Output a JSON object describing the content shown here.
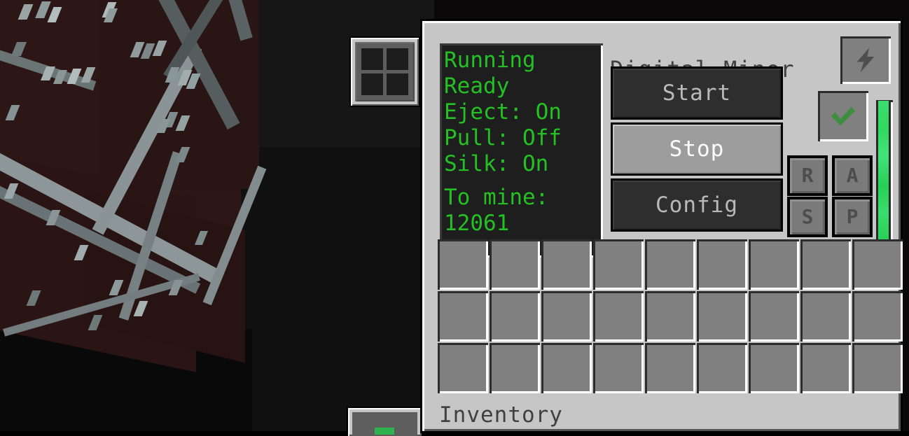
{
  "window": {
    "title": "Digital Miner",
    "inventory_label": "Inventory"
  },
  "status": {
    "lines": [
      "Running",
      "Ready",
      "Eject: On",
      "Pull: Off",
      "Silk: On"
    ],
    "to_mine_label": "To mine:",
    "to_mine_value": "12061",
    "text_color": "#24c024",
    "background_color": "#1e1e1e"
  },
  "buttons": {
    "start": "Start",
    "stop": "Stop",
    "config": "Config",
    "hovered": "Stop"
  },
  "config_buttons": [
    {
      "label": "R",
      "name": "config-button-r"
    },
    {
      "label": "A",
      "name": "config-button-a"
    },
    {
      "label": "S",
      "name": "config-button-s"
    },
    {
      "label": "P",
      "name": "config-button-p"
    }
  ],
  "icons": {
    "energy": "lightning-bolt-icon",
    "auto_eject": "checkmark-icon",
    "recipe": "crafting-grid-icon"
  },
  "energy_bar": {
    "fill_percent": 97,
    "color": "#2fd95f"
  },
  "slots": {
    "rows": 3,
    "columns": 9,
    "total": 27
  },
  "theme": {
    "panel": "#c6c6c6",
    "slot": "#808080",
    "text_dark": "#404040",
    "button_dark": "#2e2e2e",
    "button_text": "#b9b9b9"
  }
}
